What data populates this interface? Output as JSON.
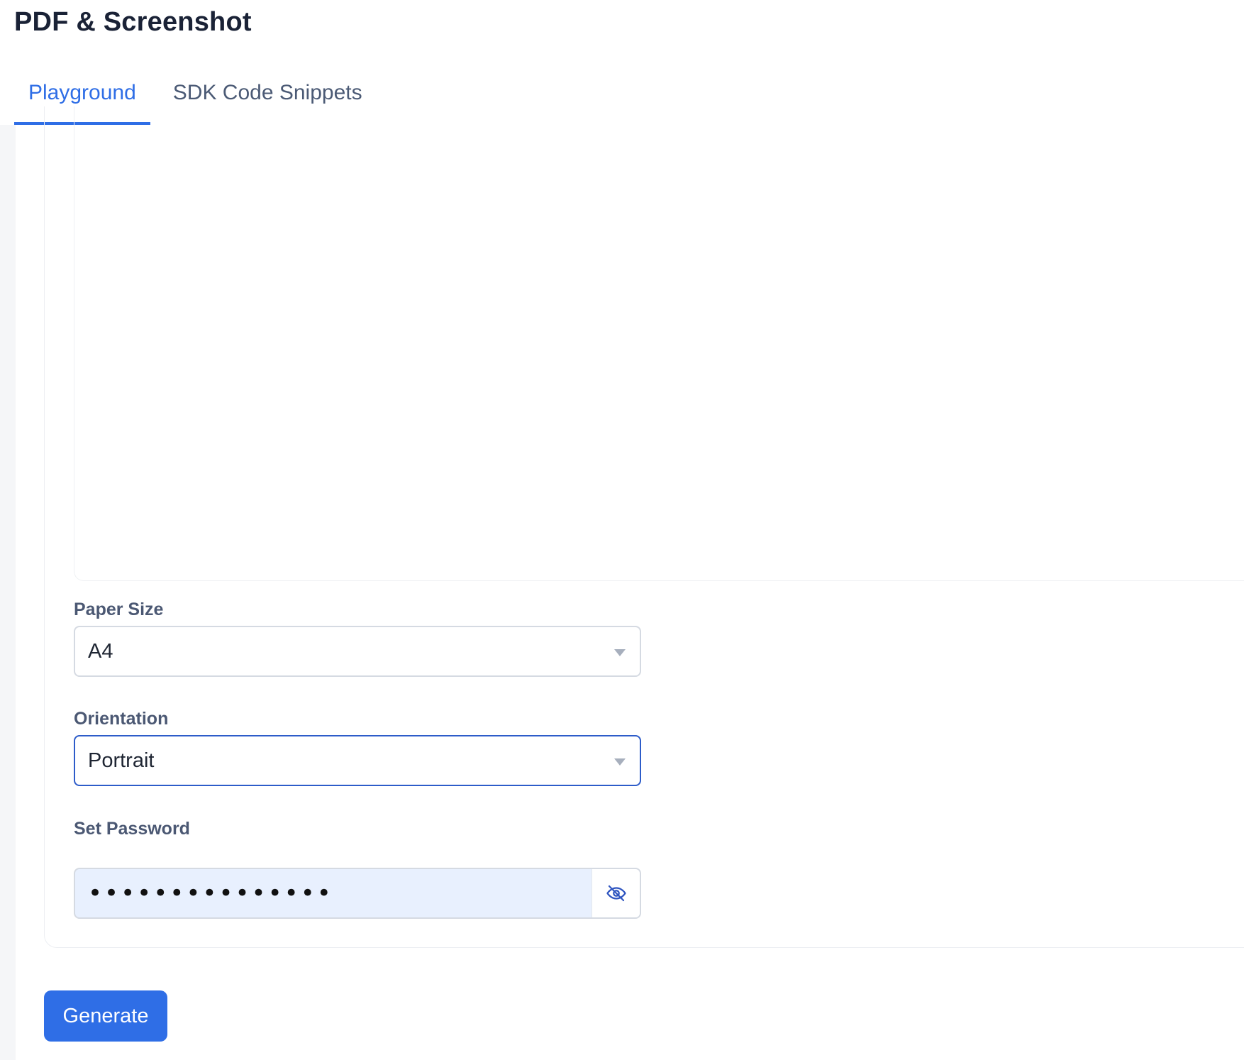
{
  "header": {
    "title": "PDF & Screenshot"
  },
  "tabs": [
    {
      "label": "Playground",
      "active": true
    },
    {
      "label": "SDK Code Snippets",
      "active": false
    }
  ],
  "form": {
    "paper_size": {
      "label": "Paper Size",
      "value": "A4"
    },
    "orientation": {
      "label": "Orientation",
      "value": "Portrait"
    },
    "password": {
      "label": "Set Password",
      "masked_value": "•••••••••••••••",
      "visibility": "hidden"
    }
  },
  "actions": {
    "generate_label": "Generate"
  },
  "colors": {
    "accent": "#2f6ee6",
    "focus_border": "#2d5cc9",
    "autofill_bg": "#e8f0fe"
  },
  "icons": {
    "caret": "chevron-down-icon",
    "password_toggle": "eye-off-icon"
  }
}
